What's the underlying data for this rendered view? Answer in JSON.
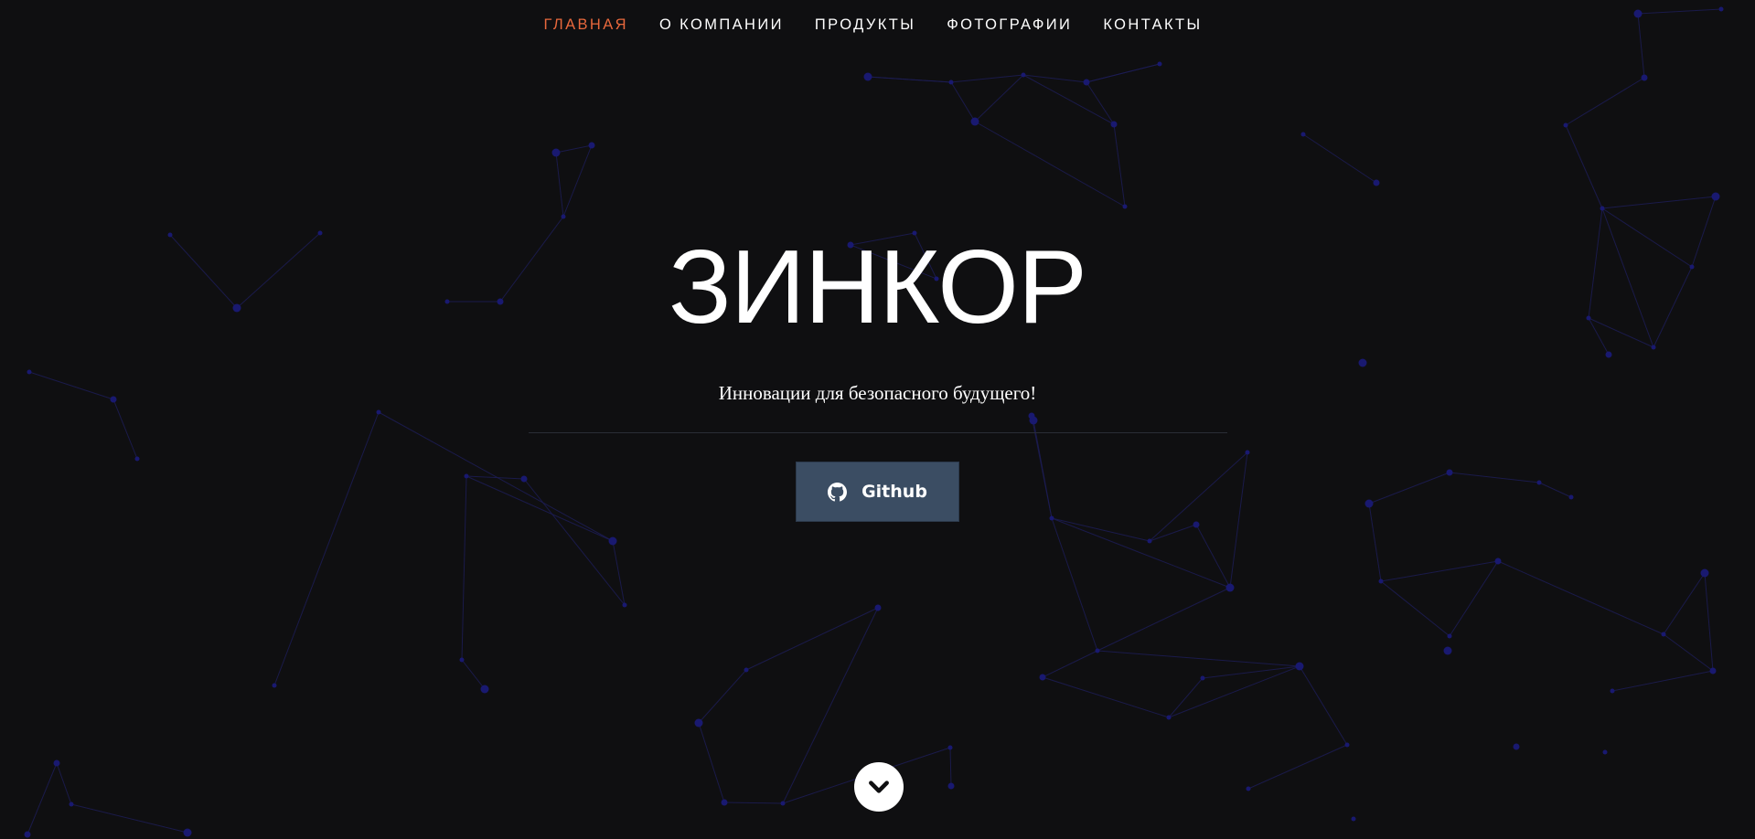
{
  "nav": {
    "items": [
      {
        "label": "ГЛАВНАЯ",
        "active": true
      },
      {
        "label": "О КОМПАНИИ",
        "active": false
      },
      {
        "label": "ПРОДУКТЫ",
        "active": false
      },
      {
        "label": "ФОТОГРАФИИ",
        "active": false
      },
      {
        "label": "КОНТАКТЫ",
        "active": false
      }
    ]
  },
  "hero": {
    "title": "ЗИНКОР",
    "subtitle": "Инновации для безопасного будущего!"
  },
  "github_button": {
    "label": "Github",
    "icon": "github-icon"
  },
  "scroll_down": {
    "icon": "chevron-down-icon"
  },
  "colors": {
    "background": "#0f0f11",
    "nav_active": "#e8683c",
    "nav_text": "#ffffff",
    "button_bg": "#3b4d63",
    "network_line": "#1d1d55",
    "network_node": "#191970"
  }
}
